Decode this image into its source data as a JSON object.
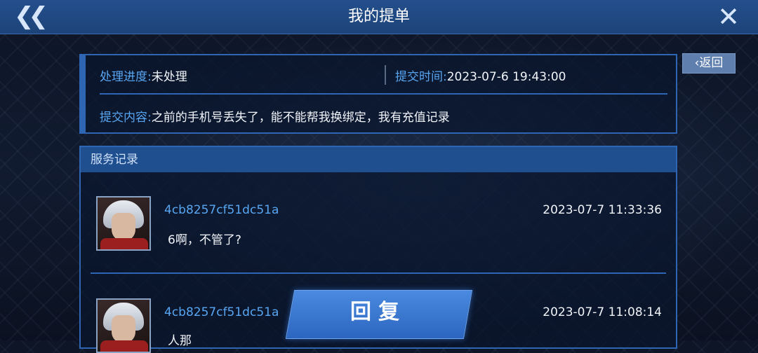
{
  "header": {
    "title": "我的提单",
    "back_icon": "double-chevron-left-icon",
    "close_icon": "close-icon"
  },
  "return_button": {
    "label": "返回",
    "icon": "chevron-left-icon"
  },
  "ticket": {
    "status_label": "处理进度:",
    "status_value": "未处理",
    "time_label": "提交时间:",
    "time_value": "2023-07-6 19:43:00",
    "content_label": "提交内容:",
    "content_value": "之前的手机号丢失了，能不能帮我换绑定，我有充值记录"
  },
  "service": {
    "title": "服务记录",
    "records": [
      {
        "user": "4cb8257cf51dc51a",
        "time": "2023-07-7 11:33:36",
        "message": "6啊，不管了?"
      },
      {
        "user": "4cb8257cf51dc51a",
        "time": "2023-07-7 11:08:14",
        "message": "人那"
      }
    ]
  },
  "reply_button": {
    "label": "回复"
  },
  "colors": {
    "accent": "#2f66b3",
    "label_blue": "#58a6f2",
    "header_bg": "#1d4479"
  }
}
